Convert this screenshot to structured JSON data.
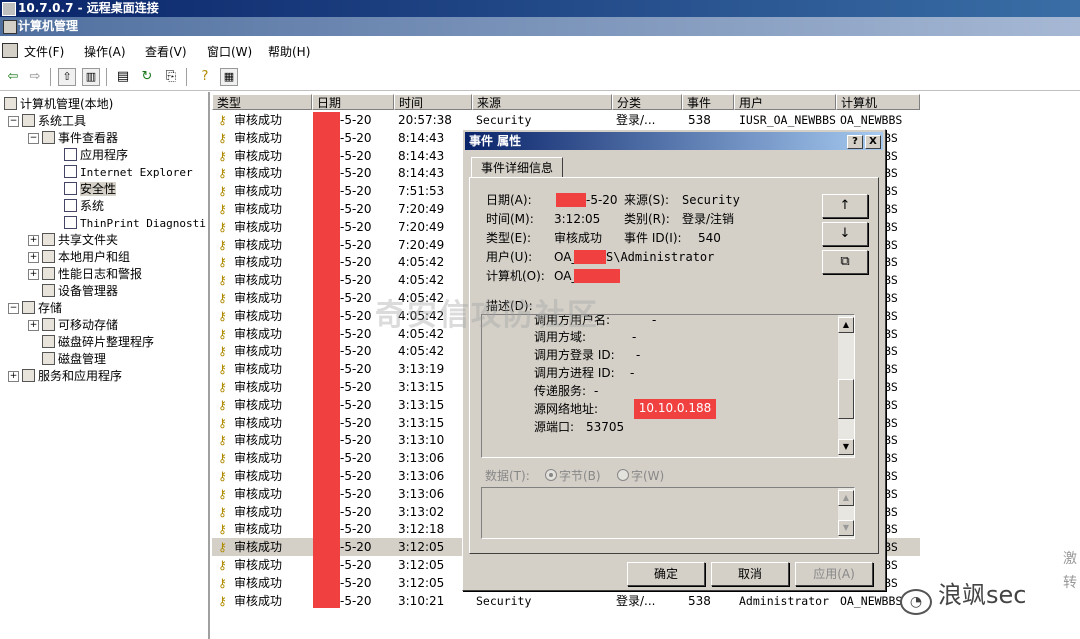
{
  "rdp": {
    "title": "10.7.0.7 - 远程桌面连接"
  },
  "window": {
    "title": "计算机管理"
  },
  "menu": {
    "file": "文件(F)",
    "action": "操作(A)",
    "view": "查看(V)",
    "window": "窗口(W)",
    "help": "帮助(H)"
  },
  "tree": {
    "root": "计算机管理(本地)",
    "system_tools": "系统工具",
    "event_viewer": "事件查看器",
    "application": "应用程序",
    "ie": "Internet Explorer",
    "security": "安全性",
    "system": "系统",
    "thinprint": "ThinPrint Diagnosti",
    "shared_folders": "共享文件夹",
    "local_users": "本地用户和组",
    "perf_logs": "性能日志和警报",
    "device_manager": "设备管理器",
    "storage": "存储",
    "removable": "可移动存储",
    "defrag": "磁盘碎片整理程序",
    "disk_mgmt": "磁盘管理",
    "services": "服务和应用程序"
  },
  "list": {
    "headers": [
      "类型",
      "日期",
      "时间",
      "来源",
      "分类",
      "事件",
      "用户",
      "计算机"
    ],
    "type_label": "审核成功",
    "date_suffix": "-5-20",
    "computer_tail": "BS",
    "first_row": {
      "source": "Security",
      "category": "登录/...",
      "event": "538",
      "user": "IUSR_OA_NEWBBS",
      "computer": "OA_NEWBBS"
    },
    "last_row": {
      "source": "Security",
      "category": "登录/...",
      "event": "538",
      "user": "Administrator",
      "computer": "OA_NEWBBS"
    },
    "times": [
      "20:57:38",
      "8:14:43",
      "8:14:43",
      "8:14:43",
      "7:51:53",
      "7:20:49",
      "7:20:49",
      "7:20:49",
      "4:05:42",
      "4:05:42",
      "4:05:42",
      "4:05:42",
      "4:05:42",
      "4:05:42",
      "3:13:19",
      "3:13:15",
      "3:13:15",
      "3:13:15",
      "3:13:10",
      "3:13:06",
      "3:13:06",
      "3:13:06",
      "3:13:02",
      "3:12:18",
      "3:12:05",
      "3:12:05",
      "3:12:05",
      "3:10:21"
    ]
  },
  "dialog": {
    "title": "事件 属性",
    "help_btn": "?",
    "close_btn": "X",
    "tab": "事件详细信息",
    "date_label": "日期(A):",
    "date_value": "-5-20",
    "source_label": "来源(S):",
    "source_value": "Security",
    "time_label": "时间(M):",
    "time_value": "3:12:05",
    "category_label": "类别(R):",
    "category_value": "登录/注销",
    "type_label": "类型(E):",
    "type_value": "审核成功",
    "eventid_label": "事件 ID(I):",
    "eventid_value": "540",
    "user_label": "用户(U):",
    "user_value_prefix": "OA_",
    "user_value_suffix": "S\\Administrator",
    "computer_label": "计算机(O):",
    "computer_value_prefix": "OA_",
    "up_btn": "↑",
    "down_btn": "↓",
    "copy_btn": "⧉",
    "desc_label": "描述(D):",
    "desc_lines": [
      "调用方用户名:",
      "调用方域:",
      "调用方登录 ID:",
      "调用方进程 ID:",
      "传递服务:",
      "源网络地址:",
      "源端口:"
    ],
    "desc_values": [
      "-",
      "-",
      "-",
      "-",
      "-",
      "",
      "53705"
    ],
    "src_ip": "10.10.0.188",
    "data_label": "数据(T):",
    "bytes_label": "字节(B)",
    "words_label": "字(W)",
    "ok": "确定",
    "cancel": "取消",
    "apply": "应用(A)"
  },
  "watermark": "奇安信攻防社区",
  "brand": {
    "name": "浪飒sec"
  },
  "side_chars": [
    "激",
    "转"
  ]
}
